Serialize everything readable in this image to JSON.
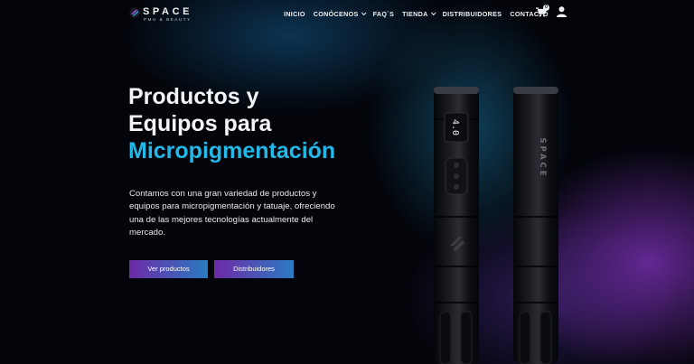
{
  "brand": {
    "name": "SPACE",
    "tagline": "PMU & BEAUTY",
    "accent_color": "#22b8e8",
    "button_gradient": [
      "#6d2aa6",
      "#2a7bc0"
    ]
  },
  "nav": {
    "items": [
      {
        "label": "INICIO",
        "dropdown": false
      },
      {
        "label": "CONÓCENOS",
        "dropdown": true
      },
      {
        "label": "FAQ´S",
        "dropdown": false
      },
      {
        "label": "TIENDA",
        "dropdown": true
      },
      {
        "label": "DISTRIBUIDORES",
        "dropdown": false
      },
      {
        "label": "CONTACTO",
        "dropdown": false
      }
    ],
    "cart_icon": "cart-icon",
    "cart_count": "0",
    "user_icon": "user-icon"
  },
  "hero": {
    "title_line1": "Productos y",
    "title_line2": "Equipos para",
    "title_accent": "Micropigmentación",
    "description": "Contamos con una gran variedad de productos y equipos para micropigmentación y tatuaje, ofreciendo una de las mejores tecnologías actualmente del mercado.",
    "primary_button": "Ver productos",
    "secondary_button": "Distribuidores"
  },
  "product_image": {
    "display_readout": "4.0",
    "pen_brand_text": "SPACE"
  }
}
